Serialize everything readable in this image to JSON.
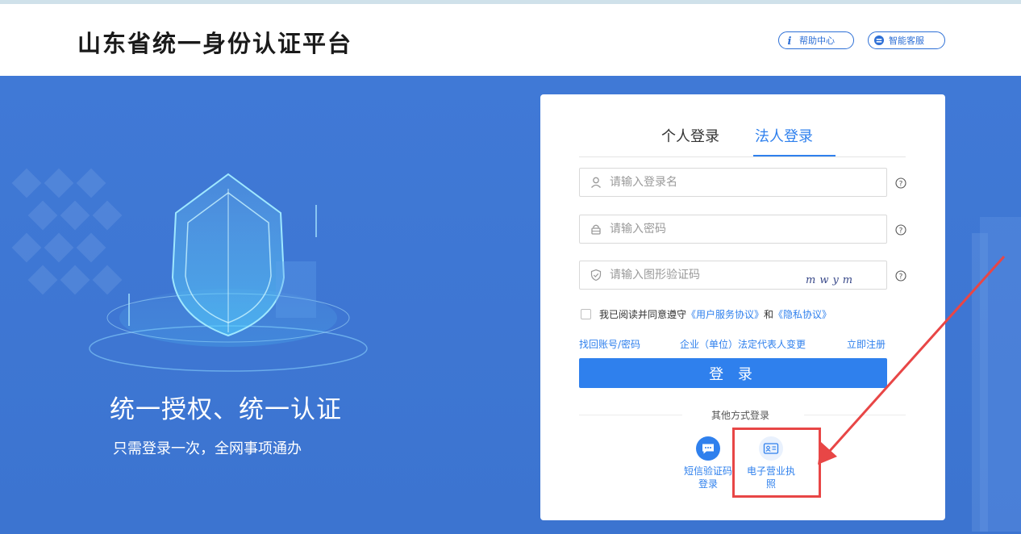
{
  "header": {
    "site_title": "山东省统一身份认证平台",
    "help_label": "帮助中心",
    "service_label": "智能客服"
  },
  "banner": {
    "slogan": "统一授权、统一认证",
    "subslogan": "只需登录一次，全网事项通办"
  },
  "login": {
    "tabs": [
      {
        "label": "个人登录",
        "active": false
      },
      {
        "label": "法人登录",
        "active": true
      }
    ],
    "username_placeholder": "请输入登录名",
    "password_placeholder": "请输入密码",
    "captcha_placeholder": "请输入图形验证码",
    "captcha_text": "mwym",
    "agree_prefix": "我已阅读并同意遵守",
    "user_agreement": "《用户服务协议》",
    "agree_and": "和",
    "privacy_agreement": "《隐私协议》",
    "recover_link": "找回账号/密码",
    "change_rep_link": "企业（单位）法定代表人变更",
    "register_link": "立即注册",
    "login_button": "登 录",
    "other_methods_label": "其他方式登录",
    "alt_methods": [
      {
        "label": "短信验证码登录",
        "icon": "sms-chat-icon"
      },
      {
        "label": "电子营业执照",
        "icon": "id-card-icon"
      }
    ]
  },
  "colors": {
    "accent": "#2f80ed",
    "banner": "#3e77d3",
    "annotation": "#e84646"
  }
}
